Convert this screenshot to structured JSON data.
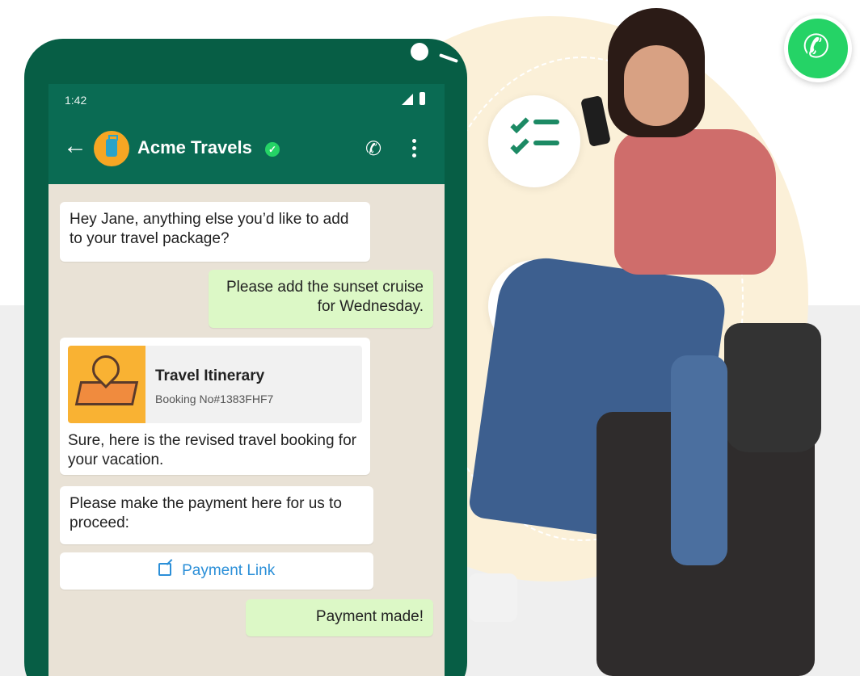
{
  "status_bar": {
    "time": "1:42"
  },
  "chat": {
    "title": "Acme Travels",
    "verified": true
  },
  "messages": [
    {
      "direction": "incoming",
      "text": "Hey Jane, anything else you’d like to add to your travel package?"
    },
    {
      "direction": "outgoing",
      "text": "Please add the sunset cruise for Wednesday."
    },
    {
      "direction": "incoming",
      "card": {
        "title": "Travel Itinerary",
        "subtitle": "Booking No#1383FHF7"
      },
      "text": "Sure, here is the revised travel booking for your vacation."
    },
    {
      "direction": "incoming",
      "text": "Please make the payment here for us to proceed:"
    },
    {
      "direction": "incoming",
      "link_label": "Payment Link"
    },
    {
      "direction": "outgoing",
      "text": "Payment made!"
    }
  ],
  "colors": {
    "whatsapp_green": "#25d366",
    "header_green": "#0a6b53",
    "outgoing_bubble": "#dcf8c6",
    "link_blue": "#2b8fd8",
    "feature_icon": "#1c8a64"
  },
  "feature_icons": [
    "checklist-icon",
    "money-icon",
    "airplane-landing-icon"
  ]
}
